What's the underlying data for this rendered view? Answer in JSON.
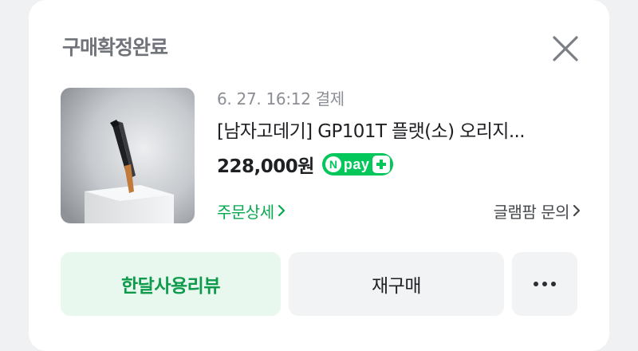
{
  "card": {
    "title": "구매확정완료",
    "close_icon": "close-icon"
  },
  "order": {
    "paid_date": "6. 27. 16:12 결제",
    "product_name": "[남자고데기] GP101T 플랫(소) 오리지...",
    "price": "228,000원",
    "npay_badge": {
      "n": "N",
      "text": "pay",
      "plus_icon": "plus-icon",
      "color": "#03c75a"
    },
    "order_detail_label": "주문상세",
    "store_inquiry_label": "글램팜 문의"
  },
  "actions": {
    "review_label": "한달사용리뷰",
    "reorder_label": "재구매",
    "more_icon": "more-dots-icon"
  },
  "colors": {
    "accent_green": "#03c75a",
    "review_bg": "#e8f8ef",
    "review_text": "#0d9b4b"
  }
}
